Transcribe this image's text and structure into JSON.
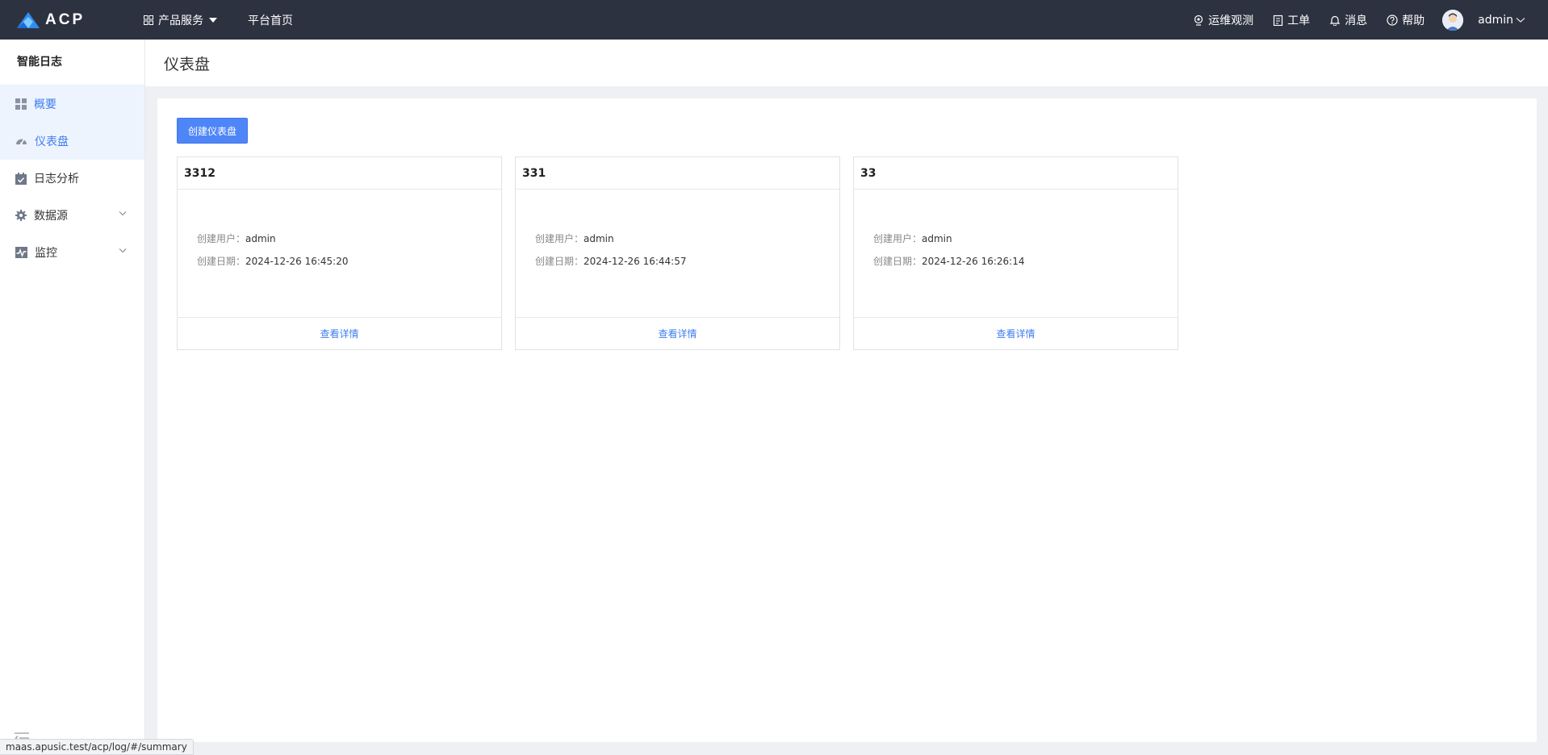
{
  "header": {
    "logo_text": "ACP",
    "nav": {
      "products": "产品服务",
      "home": "平台首页"
    },
    "right": {
      "ops": "运维观测",
      "ticket": "工单",
      "message": "消息",
      "help": "帮助",
      "user": "admin"
    }
  },
  "sidebar": {
    "title": "智能日志",
    "items": [
      {
        "label": "概要",
        "icon": "grid-icon"
      },
      {
        "label": "仪表盘",
        "icon": "dashboard-icon"
      },
      {
        "label": "日志分析",
        "icon": "calendar-icon"
      },
      {
        "label": "数据源",
        "icon": "gear-icon"
      },
      {
        "label": "监控",
        "icon": "pulse-icon"
      }
    ]
  },
  "page": {
    "title": "仪表盘",
    "create_label": "创建仪表盘"
  },
  "cards": [
    {
      "name": "3312",
      "user_label": "创建用户：",
      "user": "admin",
      "date_label": "创建日期：",
      "date": "2024-12-26 16:45:20",
      "detail": "查看详情"
    },
    {
      "name": "331",
      "user_label": "创建用户：",
      "user": "admin",
      "date_label": "创建日期：",
      "date": "2024-12-26 16:44:57",
      "detail": "查看详情"
    },
    {
      "name": "33",
      "user_label": "创建用户：",
      "user": "admin",
      "date_label": "创建日期：",
      "date": "2024-12-26 16:26:14",
      "detail": "查看详情"
    }
  ],
  "statusbar": {
    "url": "maas.apusic.test/acp/log/#/summary"
  },
  "colors": {
    "topbar": "#2d3240",
    "accent": "#3f7df0",
    "button": "#4f86f7"
  }
}
